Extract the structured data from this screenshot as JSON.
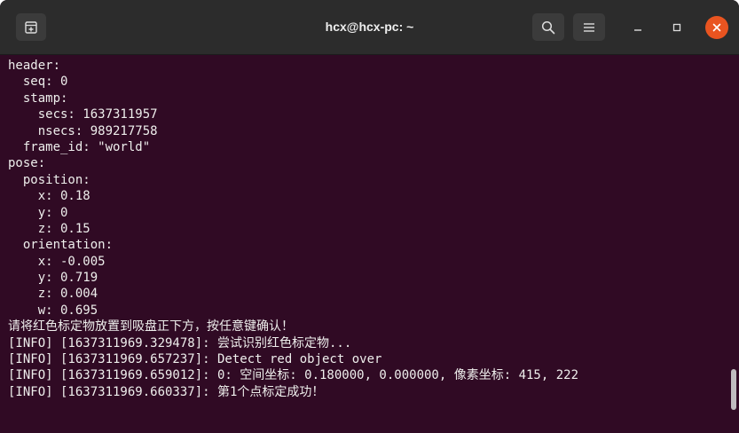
{
  "window": {
    "title": "hcx@hcx-pc: ~"
  },
  "icons": {
    "new_tab": "new-tab-icon",
    "search": "search-icon",
    "menu": "hamburger-menu-icon",
    "minimize": "minimize-icon",
    "maximize": "maximize-icon",
    "close": "close-icon"
  },
  "colors": {
    "terminal_bg": "#300a24",
    "titlebar_bg": "#2c2c2c",
    "text": "#eeeeec",
    "close_button": "#e95420"
  },
  "terminal": {
    "lines": [
      "header:",
      "  seq: 0",
      "  stamp:",
      "    secs: 1637311957",
      "    nsecs: 989217758",
      "  frame_id: \"world\"",
      "pose:",
      "  position:",
      "    x: 0.18",
      "    y: 0",
      "    z: 0.15",
      "  orientation:",
      "    x: -0.005",
      "    y: 0.719",
      "    z: 0.004",
      "    w: 0.695",
      "请将红色标定物放置到吸盘正下方，按任意键确认！",
      "[INFO] [1637311969.329478]: 尝试识别红色标定物...",
      "[INFO] [1637311969.657237]: Detect red object over",
      "[INFO] [1637311969.659012]: 0: 空间坐标: 0.180000, 0.000000, 像素坐标: 415, 222",
      "[INFO] [1637311969.660337]: 第1个点标定成功！"
    ]
  }
}
